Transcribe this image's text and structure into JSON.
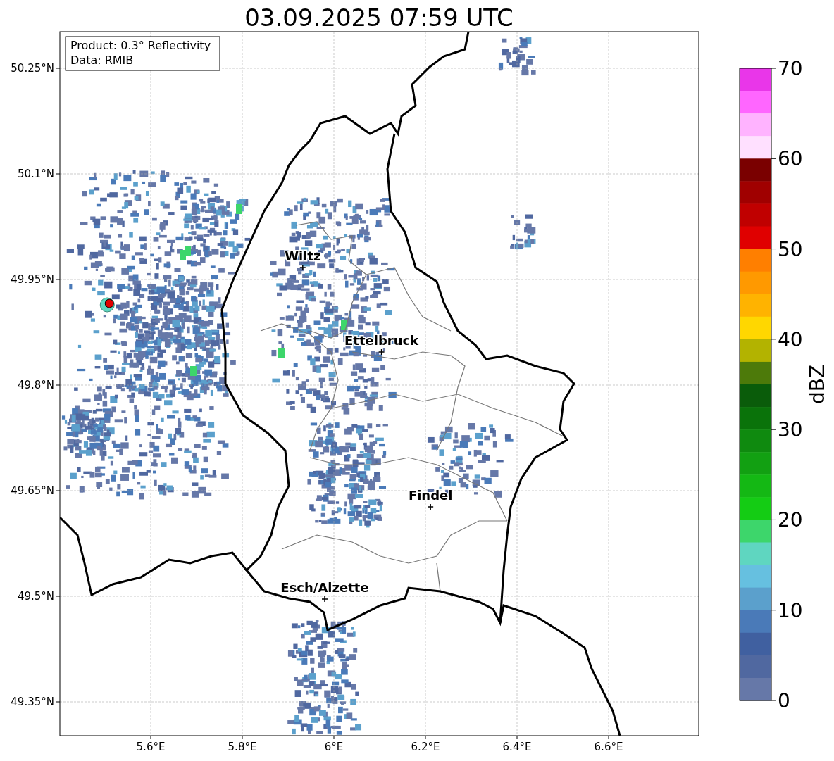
{
  "title": "03.09.2025 07:59 UTC",
  "info_box": [
    "Product: 0.3° Reflectivity",
    "Data: RMIB"
  ],
  "map": {
    "x_ticks": [
      "5.6°E",
      "5.8°E",
      "6°E",
      "6.2°E",
      "6.4°E",
      "6.6°E"
    ],
    "y_ticks": [
      "50.25°N",
      "50.1°N",
      "49.95°N",
      "49.8°N",
      "49.65°N",
      "49.5°N",
      "49.35°N"
    ],
    "places": [
      {
        "name": "Wiltz"
      },
      {
        "name": "Ettelbruck"
      },
      {
        "name": "Findel"
      },
      {
        "name": "Esch/Alzette"
      }
    ]
  },
  "colorbar": {
    "label": "dBZ",
    "ticks": [
      "70",
      "60",
      "50",
      "40",
      "30",
      "20",
      "10",
      "0"
    ],
    "colors": [
      {
        "color": "#e936e9"
      },
      {
        "color": "#ff66ff"
      },
      {
        "color": "#ffb3ff"
      },
      {
        "color": "#ffe0ff"
      },
      {
        "color": "#7a0000"
      },
      {
        "color": "#a00000"
      },
      {
        "color": "#c00000"
      },
      {
        "color": "#e00000"
      },
      {
        "color": "#ff7f00"
      },
      {
        "color": "#ff9900"
      },
      {
        "color": "#ffb300"
      },
      {
        "color": "#ffd700"
      },
      {
        "color": "#b3b300"
      },
      {
        "color": "#4d7a0a"
      },
      {
        "color": "#0a5c0a"
      },
      {
        "color": "#0a730a"
      },
      {
        "color": "#0f8a0f"
      },
      {
        "color": "#12a012"
      },
      {
        "color": "#14b814"
      },
      {
        "color": "#14cc14"
      },
      {
        "color": "#3dd66b"
      },
      {
        "color": "#5fd6c0"
      },
      {
        "color": "#66c0e0"
      },
      {
        "color": "#5ba0cc"
      },
      {
        "color": "#4a7ab8"
      },
      {
        "color": "#4060a0"
      },
      {
        "color": "#5068a0"
      },
      {
        "color": "#6678a8"
      }
    ]
  }
}
